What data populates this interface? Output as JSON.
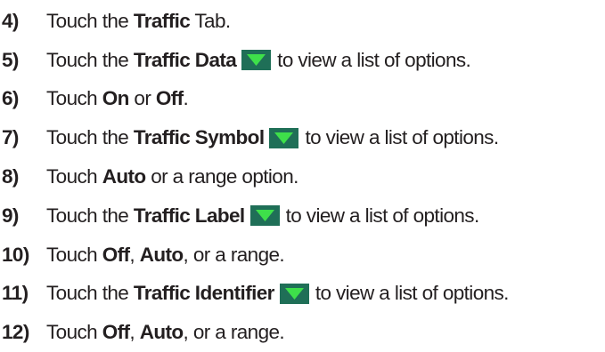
{
  "steps": [
    {
      "number": "4)",
      "parts": [
        {
          "t": "Touch the "
        },
        {
          "t": "Traffic",
          "b": true
        },
        {
          "t": " Tab."
        }
      ]
    },
    {
      "number": "5)",
      "parts": [
        {
          "t": "Touch the "
        },
        {
          "t": "Traffic Data",
          "b": true
        },
        {
          "icon": "dropdown-arrow-icon"
        },
        {
          "t": "to view a list of options."
        }
      ]
    },
    {
      "number": "6)",
      "parts": [
        {
          "t": "Touch "
        },
        {
          "t": "On",
          "b": true
        },
        {
          "t": " or "
        },
        {
          "t": "Off",
          "b": true
        },
        {
          "t": "."
        }
      ]
    },
    {
      "number": "7)",
      "parts": [
        {
          "t": "Touch the "
        },
        {
          "t": "Traffic Symbol",
          "b": true
        },
        {
          "icon": "dropdown-arrow-icon"
        },
        {
          "t": "to view a list of options."
        }
      ]
    },
    {
      "number": "8)",
      "parts": [
        {
          "t": "Touch "
        },
        {
          "t": "Auto",
          "b": true
        },
        {
          "t": " or a range option."
        }
      ]
    },
    {
      "number": "9)",
      "parts": [
        {
          "t": "Touch the "
        },
        {
          "t": "Traffic Label",
          "b": true
        },
        {
          "icon": "dropdown-arrow-icon"
        },
        {
          "t": "to view a list of options."
        }
      ]
    },
    {
      "number": "10)",
      "parts": [
        {
          "t": "Touch "
        },
        {
          "t": "Off",
          "b": true
        },
        {
          "t": ", "
        },
        {
          "t": "Auto",
          "b": true
        },
        {
          "t": ", or a range."
        }
      ]
    },
    {
      "number": "11)",
      "parts": [
        {
          "t": "Touch the "
        },
        {
          "t": "Traffic Identifier",
          "b": true
        },
        {
          "icon": "dropdown-arrow-icon"
        },
        {
          "t": "to view a list of options."
        }
      ]
    },
    {
      "number": "12)",
      "parts": [
        {
          "t": "Touch "
        },
        {
          "t": "Off",
          "b": true
        },
        {
          "t": ", "
        },
        {
          "t": "Auto",
          "b": true
        },
        {
          "t": ", or a range."
        }
      ]
    }
  ],
  "colors": {
    "text": "#231f20",
    "icon_bg": "#1f6f57",
    "icon_arrow": "#3ee04a"
  }
}
